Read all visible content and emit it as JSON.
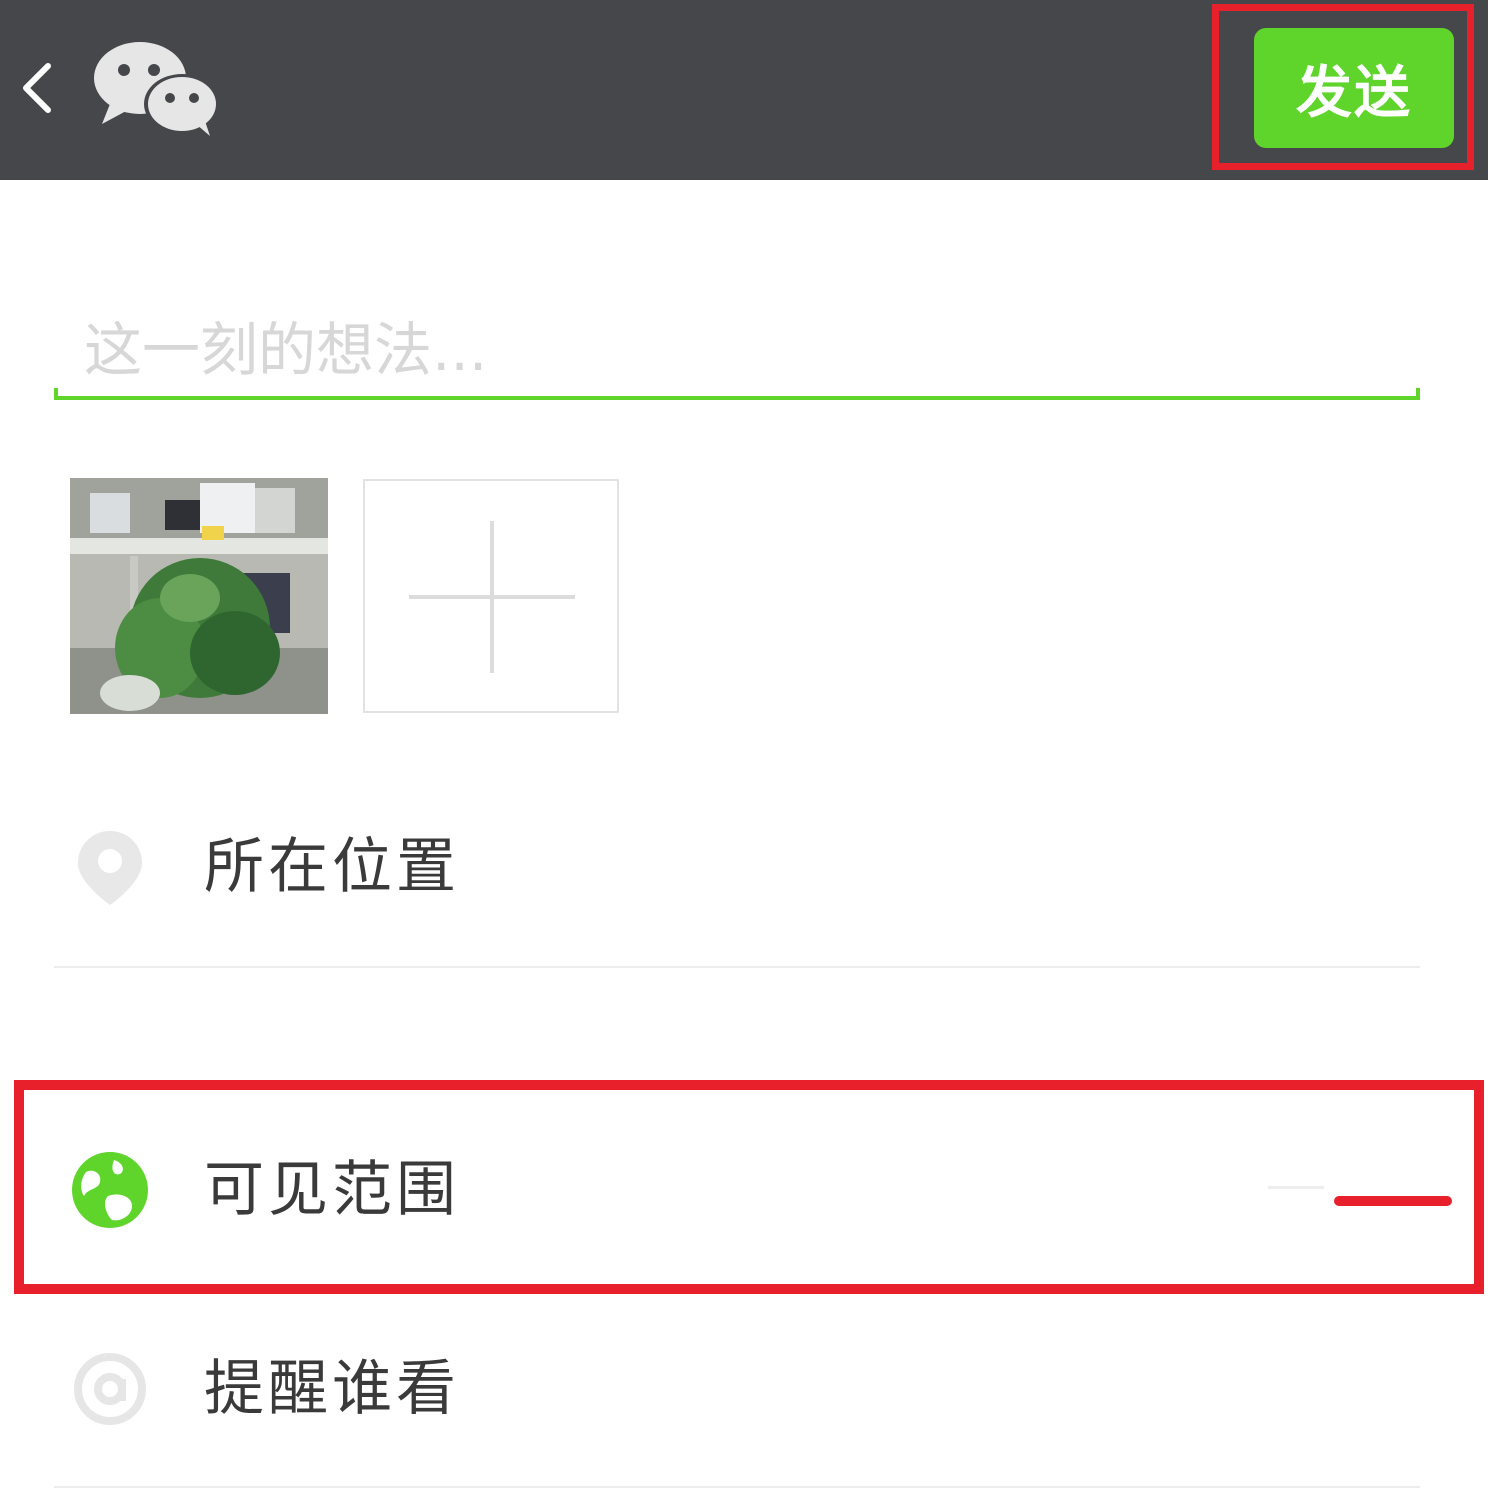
{
  "header": {
    "back_icon": "chevron-left-icon",
    "logo_icon": "wechat-logo-icon",
    "send_label": "发送",
    "colors": {
      "bar": "#46474a",
      "send": "#5fd52c",
      "highlight": "#e8202b"
    }
  },
  "compose": {
    "placeholder": "这一刻的想法...",
    "value": ""
  },
  "photos": {
    "add_icon": "plus-icon"
  },
  "options": {
    "location": {
      "label": "所在位置",
      "icon": "location-pin-icon"
    },
    "visibility": {
      "label": "可见范围",
      "icon": "globe-icon",
      "icon_color": "#5fd52c"
    },
    "remind": {
      "label": "提醒谁看",
      "icon": "at-sign-icon"
    }
  }
}
